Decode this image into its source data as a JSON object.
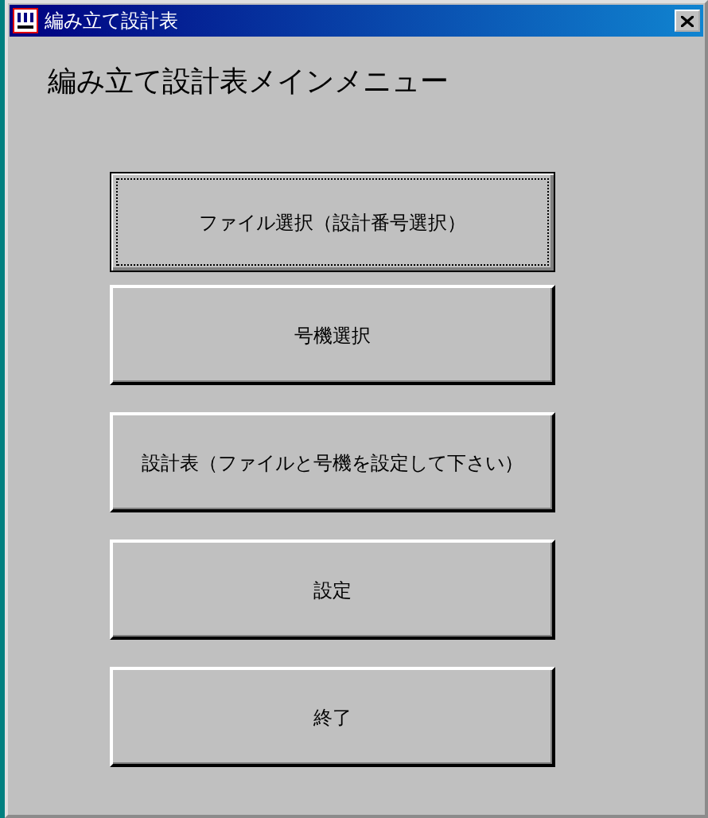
{
  "window": {
    "title": "編み立て設計表"
  },
  "heading": "編み立て設計表メインメニュー",
  "buttons": [
    {
      "label": "ファイル選択（設計番号選択）",
      "focused": true
    },
    {
      "label": "号機選択",
      "focused": false
    },
    {
      "label": "設計表（ファイルと号機を設定して下さい）",
      "focused": false
    },
    {
      "label": "設定",
      "focused": false
    },
    {
      "label": "終了",
      "focused": false
    }
  ]
}
